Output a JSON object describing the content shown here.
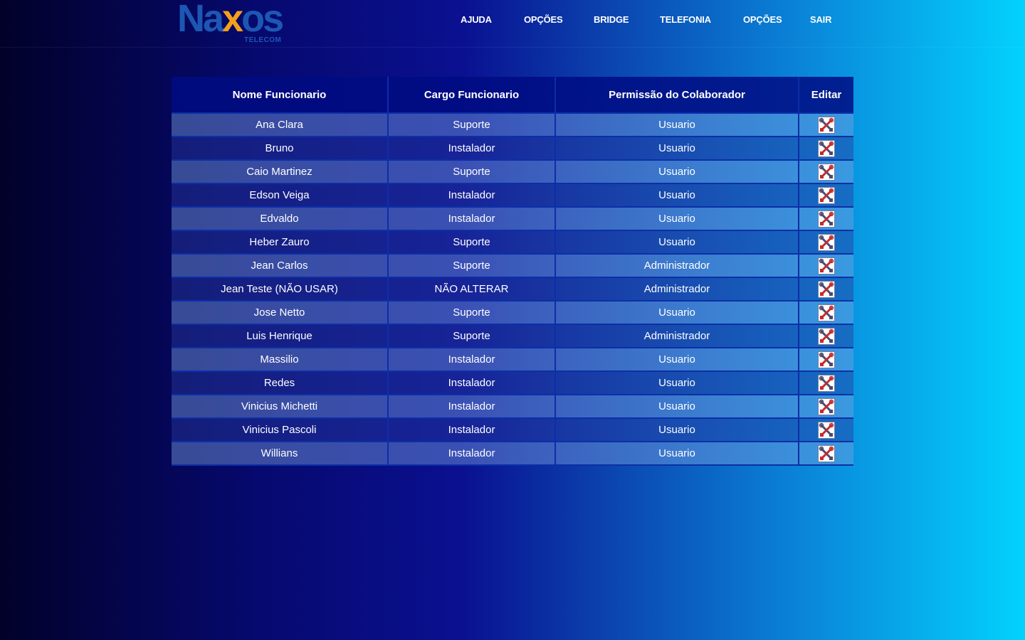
{
  "logo": {
    "word_left": "Na",
    "word_x": "x",
    "word_right": "os",
    "subtitle": "TELECOM"
  },
  "nav": [
    {
      "label": "AJUDA"
    },
    {
      "label": "OPÇÕES"
    },
    {
      "label": "BRIDGE"
    },
    {
      "label": "TELEFONIA"
    },
    {
      "label": "OPÇÕES"
    },
    {
      "label": "SAIR"
    }
  ],
  "table": {
    "headers": [
      "Nome Funcionario",
      "Cargo Funcionario",
      "Permissão do Colaborador",
      "Editar"
    ],
    "rows": [
      {
        "nome": "Ana Clara",
        "cargo": "Suporte",
        "permissao": "Usuario"
      },
      {
        "nome": "Bruno",
        "cargo": "Instalador",
        "permissao": "Usuario"
      },
      {
        "nome": "Caio Martinez",
        "cargo": "Suporte",
        "permissao": "Usuario"
      },
      {
        "nome": "Edson Veiga",
        "cargo": "Instalador",
        "permissao": "Usuario"
      },
      {
        "nome": "Edvaldo",
        "cargo": "Instalador",
        "permissao": "Usuario"
      },
      {
        "nome": "Heber Zauro",
        "cargo": "Suporte",
        "permissao": "Usuario"
      },
      {
        "nome": "Jean Carlos",
        "cargo": "Suporte",
        "permissao": "Administrador"
      },
      {
        "nome": "Jean Teste (NÃO USAR)",
        "cargo": "NÃO ALTERAR",
        "permissao": "Administrador"
      },
      {
        "nome": "Jose Netto",
        "cargo": "Suporte",
        "permissao": "Usuario"
      },
      {
        "nome": "Luis Henrique",
        "cargo": "Suporte",
        "permissao": "Administrador"
      },
      {
        "nome": "Massilio",
        "cargo": "Instalador",
        "permissao": "Usuario"
      },
      {
        "nome": "Redes",
        "cargo": "Instalador",
        "permissao": "Usuario"
      },
      {
        "nome": "Vinicius Michetti",
        "cargo": "Instalador",
        "permissao": "Usuario"
      },
      {
        "nome": "Vinicius Pascoli",
        "cargo": "Instalador",
        "permissao": "Usuario"
      },
      {
        "nome": "Willians",
        "cargo": "Instalador",
        "permissao": "Usuario"
      }
    ],
    "edit_icon": "tools-icon"
  },
  "colors": {
    "logo_blue": "#1d57b4",
    "logo_orange": "#f4a11a",
    "background_left": "#02012a",
    "background_right": "#03d2fd"
  }
}
